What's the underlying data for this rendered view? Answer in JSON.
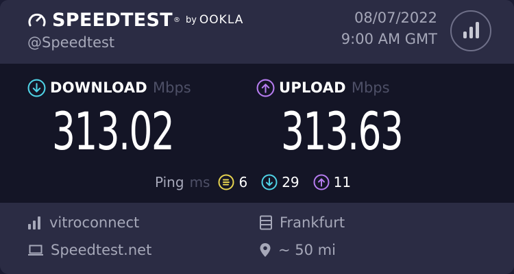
{
  "header": {
    "brand": "SPEEDTEST",
    "by": "by",
    "ookla": "OOKLA",
    "handle": "@Speedtest",
    "date": "08/07/2022",
    "time": "9:00 AM GMT"
  },
  "download": {
    "label": "DOWNLOAD",
    "unit": "Mbps",
    "value": "313.02"
  },
  "upload": {
    "label": "UPLOAD",
    "unit": "Mbps",
    "value": "313.63"
  },
  "ping": {
    "label": "Ping",
    "unit": "ms",
    "idle": "6",
    "download": "29",
    "upload": "11"
  },
  "footer": {
    "isp": "vitroconnect",
    "site": "Speedtest.net",
    "server": "Frankfurt",
    "distance": "~ 50 mi"
  },
  "colors": {
    "download": "#4fd3e6",
    "upload": "#b67cf0",
    "idle": "#e7d44f"
  }
}
